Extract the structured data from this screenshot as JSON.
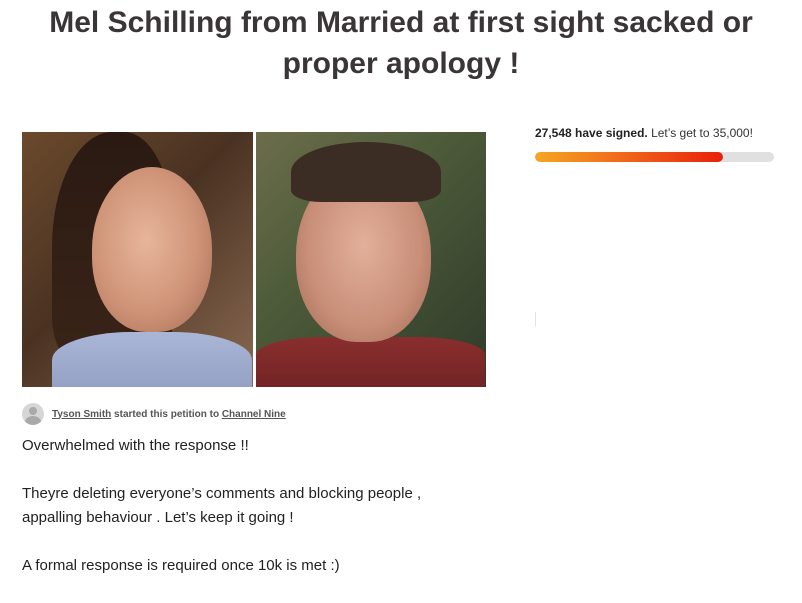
{
  "petition": {
    "title": "Mel Schilling from Married at first sight sacked or proper apology !",
    "starter": {
      "name": "Tyson Smith",
      "middle_text": "started this petition to",
      "target": "Channel Nine"
    },
    "body": {
      "line1": "Overwhelmed with the response !!",
      "line2a": "Theyre deleting everyone’s comments and blocking people ,",
      "line2b": "appalling behaviour . Let’s keep it going !",
      "line3": "A formal response is required once 10k is met :)"
    }
  },
  "signatures": {
    "count_text": "27,548 have signed.",
    "goal_text": "Let’s get to 35,000!",
    "progress_fraction": 0.787,
    "progress_colors": [
      "#f5a623",
      "#e8200a"
    ]
  },
  "icons": {
    "avatar": "user-avatar-placeholder-icon"
  }
}
